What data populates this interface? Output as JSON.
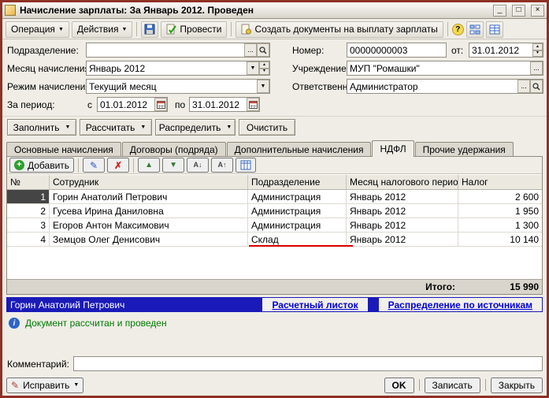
{
  "window": {
    "title": "Начисление зарплаты: За Январь 2012. Проведен"
  },
  "titlebar": {
    "minimize": "_",
    "maximize": "□",
    "close": "×"
  },
  "toolbar": {
    "operation_label": "Операция",
    "actions_label": "Действия",
    "post_label": "Провести",
    "create_docs_label": "Создать документы на выплату зарплаты",
    "help_glyph": "?"
  },
  "form": {
    "department": {
      "label": "Подразделение:",
      "value": ""
    },
    "number": {
      "label": "Номер:",
      "value": "00000000003"
    },
    "date": {
      "label": "от:",
      "value": "31.01.2012"
    },
    "month": {
      "label": "Месяц начисления:",
      "value": "Январь 2012"
    },
    "institution": {
      "label": "Учреждение:",
      "value": "МУП \"Ромашки\""
    },
    "mode": {
      "label": "Режим начисления:",
      "value": "Текущий месяц"
    },
    "responsible": {
      "label": "Ответственный:",
      "value": "Администратор"
    },
    "period": {
      "label": "За период:",
      "from_label": "с",
      "from_value": "01.01.2012",
      "to_label": "по",
      "to_value": "31.01.2012"
    }
  },
  "action_buttons": [
    {
      "label": "Заполнить",
      "dropdown": true
    },
    {
      "label": "Рассчитать",
      "dropdown": true
    },
    {
      "label": "Распределить",
      "dropdown": true
    },
    {
      "label": "Очистить",
      "dropdown": false
    }
  ],
  "tabs": [
    {
      "label": "Основные начисления",
      "active": false
    },
    {
      "label": "Договоры (подряда)",
      "active": false
    },
    {
      "label": "Дополнительные начисления",
      "active": false
    },
    {
      "label": "НДФЛ",
      "active": true
    },
    {
      "label": "Прочие удержания",
      "active": false
    }
  ],
  "grid": {
    "toolbar": {
      "add_label": "Добавить"
    },
    "columns": [
      "№",
      "Сотрудник",
      "Подразделение",
      "Месяц налогового перио...",
      "Налог"
    ],
    "rows": [
      {
        "num": "1",
        "employee": "Горин Анатолий Петрович",
        "department": "Администрация",
        "period": "Январь 2012",
        "tax": "2 600"
      },
      {
        "num": "2",
        "employee": "Гусева Ирина Даниловна",
        "department": "Администрация",
        "period": "Январь 2012",
        "tax": "1 950"
      },
      {
        "num": "3",
        "employee": "Егоров Антон Максимович",
        "department": "Администрация",
        "period": "Январь 2012",
        "tax": "1 300"
      },
      {
        "num": "4",
        "employee": "Земцов Олег Денисович",
        "department": "Склад",
        "period": "Январь 2012",
        "tax": "10 140"
      }
    ],
    "total_label": "Итого:",
    "total_value": "15 990"
  },
  "footer_bar": {
    "selected_employee": "Горин Анатолий Петрович",
    "payslip_link": "Расчетный листок",
    "sources_link": "Распределение по источникам"
  },
  "status": {
    "text": "Документ рассчитан и проведен",
    "info_glyph": "i"
  },
  "comment": {
    "label": "Комментарий:",
    "value": ""
  },
  "bottom": {
    "fix_label": "Исправить",
    "ok_label": "OK",
    "save_label": "Записать",
    "close_label": "Закрыть"
  },
  "icons": {
    "dropdown_arrow": "▼",
    "ellipsis": "...",
    "add": "+",
    "edit": "✎",
    "delete": "✗",
    "move_up": "▲",
    "move_down": "▼",
    "sort_asc": "А↓",
    "sort_desc": "А↑",
    "fix": "✎"
  },
  "colors": {
    "window_border": "#8E3125",
    "selection_bar_blue": "#1A1AB8",
    "link_blue": "#0000D4",
    "status_green": "#007A00",
    "highlight_red": "#D80000"
  }
}
